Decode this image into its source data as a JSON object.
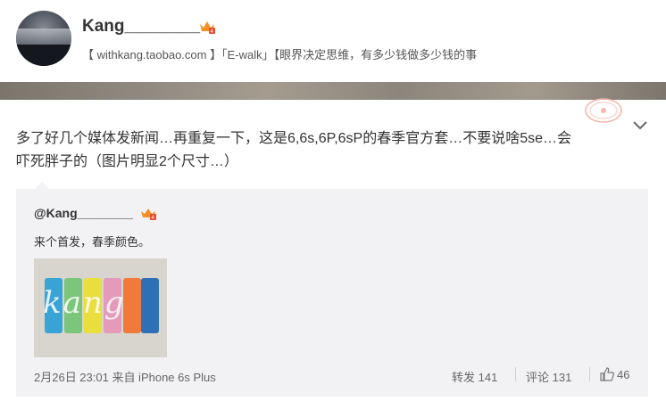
{
  "profile": {
    "username": "Kang________",
    "bio": "【 withkang.taobao.com 】「E-walk」【眼界决定思维，有多少钱做多少钱的事"
  },
  "post": {
    "text_line1": "多了好几个媒体发新闻…再重复一下，这是6,6s,6P,6sP的春季官方套…不要说啥5se…会",
    "text_line2": "吓死胖子的（图片明显2个尺寸…）"
  },
  "quoted": {
    "user": "@Kang________",
    "text": "来个首发，春季颜色。",
    "image_watermark": "kang",
    "date": "2月26日 23:01 来自 iPhone 6s Plus",
    "repost": "转发 141",
    "comment": "评论 131",
    "likes": "46",
    "case_colors": [
      "#3aa3d6",
      "#7bc67a",
      "#e8de3c",
      "#e59ab9",
      "#f07a3c",
      "#2f6fb5"
    ]
  },
  "colors": {
    "accent": "#eb7350",
    "vip": "#f29023"
  }
}
